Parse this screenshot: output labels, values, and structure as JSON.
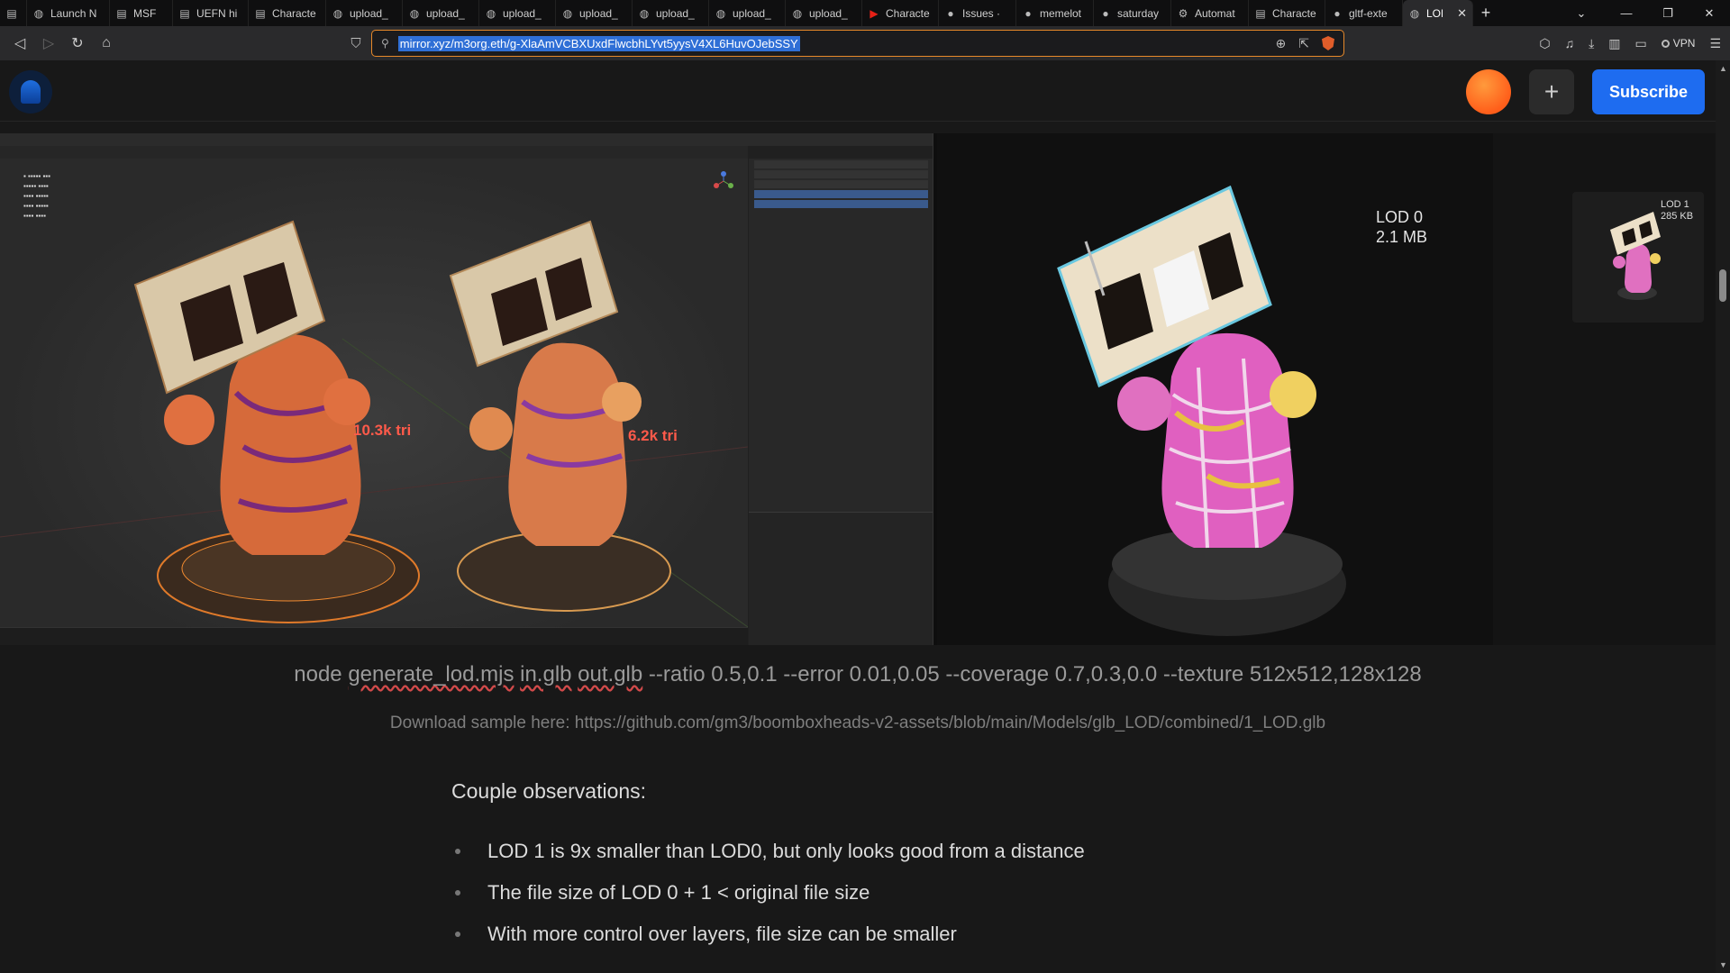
{
  "browser": {
    "tabs": [
      {
        "icon": "document-icon",
        "label": ""
      },
      {
        "icon": "globe-icon",
        "label": "Launch N"
      },
      {
        "icon": "document-icon",
        "label": "MSF"
      },
      {
        "icon": "document-icon",
        "label": "UEFN hi"
      },
      {
        "icon": "document-icon",
        "label": "Characte"
      },
      {
        "icon": "globe-icon",
        "label": "upload_"
      },
      {
        "icon": "globe-icon",
        "label": "upload_"
      },
      {
        "icon": "globe-icon",
        "label": "upload_"
      },
      {
        "icon": "globe-icon",
        "label": "upload_"
      },
      {
        "icon": "globe-icon",
        "label": "upload_"
      },
      {
        "icon": "globe-icon",
        "label": "upload_"
      },
      {
        "icon": "globe-icon",
        "label": "upload_"
      },
      {
        "icon": "youtube-icon",
        "label": "Characte"
      },
      {
        "icon": "github-icon",
        "label": "Issues ·"
      },
      {
        "icon": "github-icon",
        "label": "memelot"
      },
      {
        "icon": "github-icon",
        "label": "saturday"
      },
      {
        "icon": "gear-icon",
        "label": "Automat"
      },
      {
        "icon": "document-icon",
        "label": "Characte"
      },
      {
        "icon": "github-icon",
        "label": "gltf-exte"
      },
      {
        "icon": "globe-icon",
        "label": "LOD",
        "active": true
      }
    ],
    "url": "mirror.xyz/m3org.eth/g-XlaAmVCBXUxdFlwcbhLYvt5yysV4XL6HuvOJebSSY",
    "vpn_label": "VPN",
    "accent_color": "#e8892a"
  },
  "header": {
    "subscribe_label": "Subscribe",
    "plus_label": "+"
  },
  "hero": {
    "left_tri_label": "10.3k tri",
    "right_tri_label": "6.2k tri",
    "lod0_line1": "LOD 0",
    "lod0_line2": "2.1 MB",
    "lod1_line1": "LOD 1",
    "lod1_line2": "285 KB"
  },
  "article": {
    "cmd_parts": [
      "node ",
      "generate_lod.mjs",
      " ",
      "in.glb",
      " ",
      "out.glb",
      " --ratio 0.5,0.1 --error 0.01,0.05 --coverage 0.7,0.3,0.0 --texture 512x512,128x128"
    ],
    "download_text": "Download sample here: https://github.com/gm3/boomboxheads-v2-assets/blob/main/Models/glb_LOD/combined/1_LOD.glb",
    "observations_title": "Couple observations:",
    "observations": [
      "LOD 1 is 9x smaller than LOD0, but only looks good from a distance",
      "The file size of LOD 0 + 1 < original file size",
      "With more control over layers, file size can be smaller"
    ]
  }
}
